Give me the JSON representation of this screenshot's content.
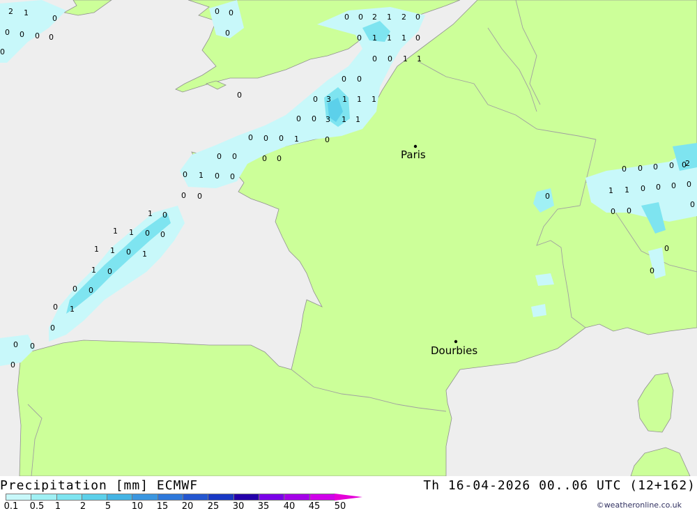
{
  "title": {
    "left": "Precipitation [mm] ECMWF",
    "right": "Th 16-04-2026 00..06 UTC (12+162)"
  },
  "credit": "©weatheronline.co.uk",
  "colors": {
    "land": "#ccff99",
    "sea": "#eeeeee",
    "border": "#a0a0a0",
    "coast": "#909090"
  },
  "legend": {
    "ticks": [
      "0.1",
      "0.5",
      "1",
      "2",
      "5",
      "10",
      "15",
      "20",
      "25",
      "30",
      "35",
      "40",
      "45",
      "50"
    ],
    "colors": [
      "#c8f8fa",
      "#a0f0f4",
      "#7ee4f0",
      "#5cd0ea",
      "#44b4e4",
      "#3a96e0",
      "#2e78da",
      "#2356d0",
      "#1838c4",
      "#2400aa",
      "#7a00e8",
      "#a400e8",
      "#d000ea",
      "#e400d8"
    ]
  },
  "cities": [
    {
      "name": "Paris"
    },
    {
      "name": "Dourbies"
    }
  ],
  "values": [
    "2",
    "1",
    "0",
    "0",
    "0",
    "0",
    "0",
    "0",
    "0",
    "0",
    "0",
    "0",
    "2",
    "1",
    "2",
    "0",
    "0",
    "1",
    "1",
    "1",
    "0",
    "0",
    "0",
    "1",
    "1",
    "0",
    "0",
    "0",
    "0",
    "3",
    "1",
    "1",
    "1",
    "0",
    "0",
    "3",
    "1",
    "1",
    "0",
    "0",
    "0",
    "1",
    "0",
    "0",
    "0",
    "0",
    "0",
    "0",
    "0",
    "1",
    "0",
    "0",
    "0",
    "0",
    "1",
    "0",
    "1",
    "1",
    "0",
    "0",
    "1",
    "1",
    "0",
    "1",
    "0",
    "1",
    "0",
    "0",
    "1",
    "0",
    "0",
    "0",
    "0",
    "0",
    "0",
    "0",
    "0",
    "0",
    "0",
    "2",
    "1",
    "1",
    "0",
    "0",
    "0",
    "0",
    "0",
    "0",
    "0",
    "0",
    "0",
    "0"
  ]
}
